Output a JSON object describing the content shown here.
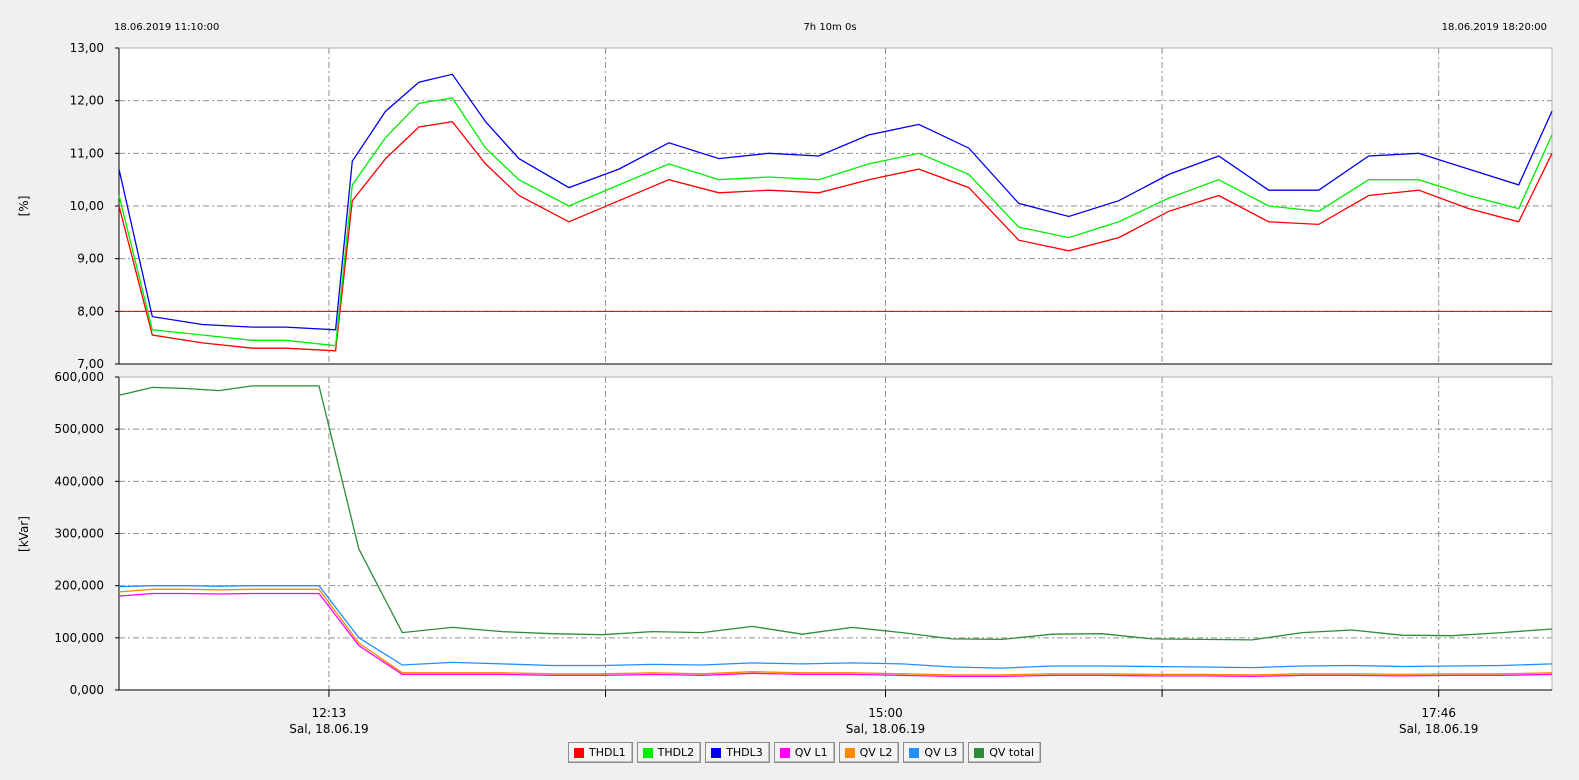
{
  "header": {
    "start": "18.06.2019 11:10:00",
    "span": "7h 10m 0s",
    "end": "18.06.2019 18:20:00"
  },
  "x_axis": {
    "major_ticks": [
      {
        "time": "12:13",
        "date": "Sal, 18.06.19"
      },
      {
        "time": "15:00",
        "date": "Sal, 18.06.19"
      },
      {
        "time": "17:46",
        "date": "Sal, 18.06.19"
      }
    ]
  },
  "chart_data": [
    {
      "type": "line",
      "ylabel": "[%]",
      "ylim": [
        7.0,
        13.0
      ],
      "yticks": [
        "13,00",
        "12,00",
        "11,00",
        "10,00",
        "9,00",
        "8,00",
        "7,00"
      ],
      "x_range": [
        "11:10",
        "18:20"
      ],
      "grid": true,
      "threshold": {
        "value": 8.0,
        "color": "#cc0000"
      },
      "x": [
        "11:10",
        "11:20",
        "11:35",
        "11:50",
        "12:00",
        "12:15",
        "12:20",
        "12:30",
        "12:40",
        "12:50",
        "13:00",
        "13:10",
        "13:25",
        "13:40",
        "13:55",
        "14:10",
        "14:25",
        "14:40",
        "14:55",
        "15:10",
        "15:25",
        "15:40",
        "15:55",
        "16:10",
        "16:25",
        "16:40",
        "16:55",
        "17:10",
        "17:25",
        "17:40",
        "17:55",
        "18:10",
        "18:20"
      ],
      "series": [
        {
          "name": "THDL1",
          "color": "#ff0000",
          "values": [
            10.0,
            7.55,
            7.4,
            7.3,
            7.3,
            7.25,
            10.1,
            10.9,
            11.5,
            11.6,
            10.8,
            10.2,
            9.7,
            10.1,
            10.5,
            10.25,
            10.3,
            10.25,
            10.5,
            10.7,
            10.35,
            9.35,
            9.15,
            9.4,
            9.9,
            10.2,
            9.7,
            9.65,
            10.2,
            10.3,
            9.95,
            9.7,
            11.0
          ]
        },
        {
          "name": "THDL2",
          "color": "#00ee00",
          "values": [
            10.2,
            7.65,
            7.55,
            7.45,
            7.45,
            7.35,
            10.4,
            11.3,
            11.95,
            12.05,
            11.1,
            10.5,
            10.0,
            10.4,
            10.8,
            10.5,
            10.55,
            10.5,
            10.8,
            11.0,
            10.6,
            9.6,
            9.4,
            9.7,
            10.15,
            10.5,
            10.0,
            9.9,
            10.5,
            10.5,
            10.2,
            9.95,
            11.35
          ]
        },
        {
          "name": "THDL3",
          "color": "#0000ee",
          "values": [
            10.7,
            7.9,
            7.75,
            7.7,
            7.7,
            7.65,
            10.85,
            11.8,
            12.35,
            12.5,
            11.6,
            10.9,
            10.35,
            10.7,
            11.2,
            10.9,
            11.0,
            10.95,
            11.35,
            11.55,
            11.1,
            10.05,
            9.8,
            10.1,
            10.6,
            10.95,
            10.3,
            10.3,
            10.95,
            11.0,
            10.7,
            10.4,
            11.8
          ]
        }
      ]
    },
    {
      "type": "line",
      "ylabel": "[kVar]",
      "ylim": [
        0,
        600000
      ],
      "yticks": [
        "600,000",
        "500,000",
        "400,000",
        "300,000",
        "200,000",
        "100,000",
        "0,000"
      ],
      "x_range": [
        "11:10",
        "18:20"
      ],
      "grid": true,
      "x": [
        "11:10",
        "11:20",
        "11:30",
        "11:40",
        "11:50",
        "12:00",
        "12:10",
        "12:22",
        "12:35",
        "12:50",
        "13:05",
        "13:20",
        "13:35",
        "13:50",
        "14:05",
        "14:20",
        "14:35",
        "14:50",
        "15:05",
        "15:20",
        "15:35",
        "15:50",
        "16:05",
        "16:20",
        "16:35",
        "16:50",
        "17:05",
        "17:20",
        "17:35",
        "17:50",
        "18:05",
        "18:20"
      ],
      "series": [
        {
          "name": "QV L1",
          "color": "#ff00ff",
          "values": [
            180000,
            185000,
            185000,
            184000,
            185000,
            185000,
            185000,
            85000,
            30000,
            30000,
            30000,
            28000,
            28000,
            30000,
            28000,
            32000,
            30000,
            30000,
            28000,
            26000,
            26000,
            28000,
            28000,
            27000,
            27000,
            26000,
            28000,
            28000,
            27000,
            28000,
            28000,
            30000
          ]
        },
        {
          "name": "QV L2",
          "color": "#ff8800",
          "values": [
            188000,
            193000,
            193000,
            192000,
            193000,
            193000,
            193000,
            90000,
            33000,
            33000,
            33000,
            31000,
            31000,
            33000,
            31000,
            35000,
            33000,
            33000,
            31000,
            29000,
            29000,
            31000,
            31000,
            30000,
            30000,
            29000,
            31000,
            31000,
            30000,
            31000,
            31000,
            33000
          ]
        },
        {
          "name": "QV L3",
          "color": "#1e90ff",
          "values": [
            198000,
            200000,
            200000,
            199000,
            200000,
            200000,
            200000,
            100000,
            48000,
            53000,
            50000,
            47000,
            47000,
            49000,
            48000,
            52000,
            50000,
            52000,
            50000,
            44000,
            42000,
            46000,
            46000,
            45000,
            44000,
            43000,
            46000,
            47000,
            45000,
            46000,
            47000,
            50000
          ]
        },
        {
          "name": "QV total",
          "color": "#2e8b3a",
          "values": [
            565000,
            580000,
            578000,
            574000,
            583000,
            583000,
            583000,
            270000,
            110000,
            120000,
            112000,
            108000,
            106000,
            112000,
            110000,
            122000,
            107000,
            120000,
            110000,
            98000,
            97000,
            107000,
            108000,
            98000,
            97000,
            96000,
            110000,
            115000,
            105000,
            104000,
            110000,
            117000
          ]
        }
      ]
    }
  ],
  "legend": [
    {
      "name": "THDL1",
      "color": "#ff0000"
    },
    {
      "name": "THDL2",
      "color": "#00ee00"
    },
    {
      "name": "THDL3",
      "color": "#0000ee"
    },
    {
      "name": "QV L1",
      "color": "#ff00ff"
    },
    {
      "name": "QV L2",
      "color": "#ff8800"
    },
    {
      "name": "QV L3",
      "color": "#1e90ff"
    },
    {
      "name": "QV total",
      "color": "#2e8b3a"
    }
  ]
}
